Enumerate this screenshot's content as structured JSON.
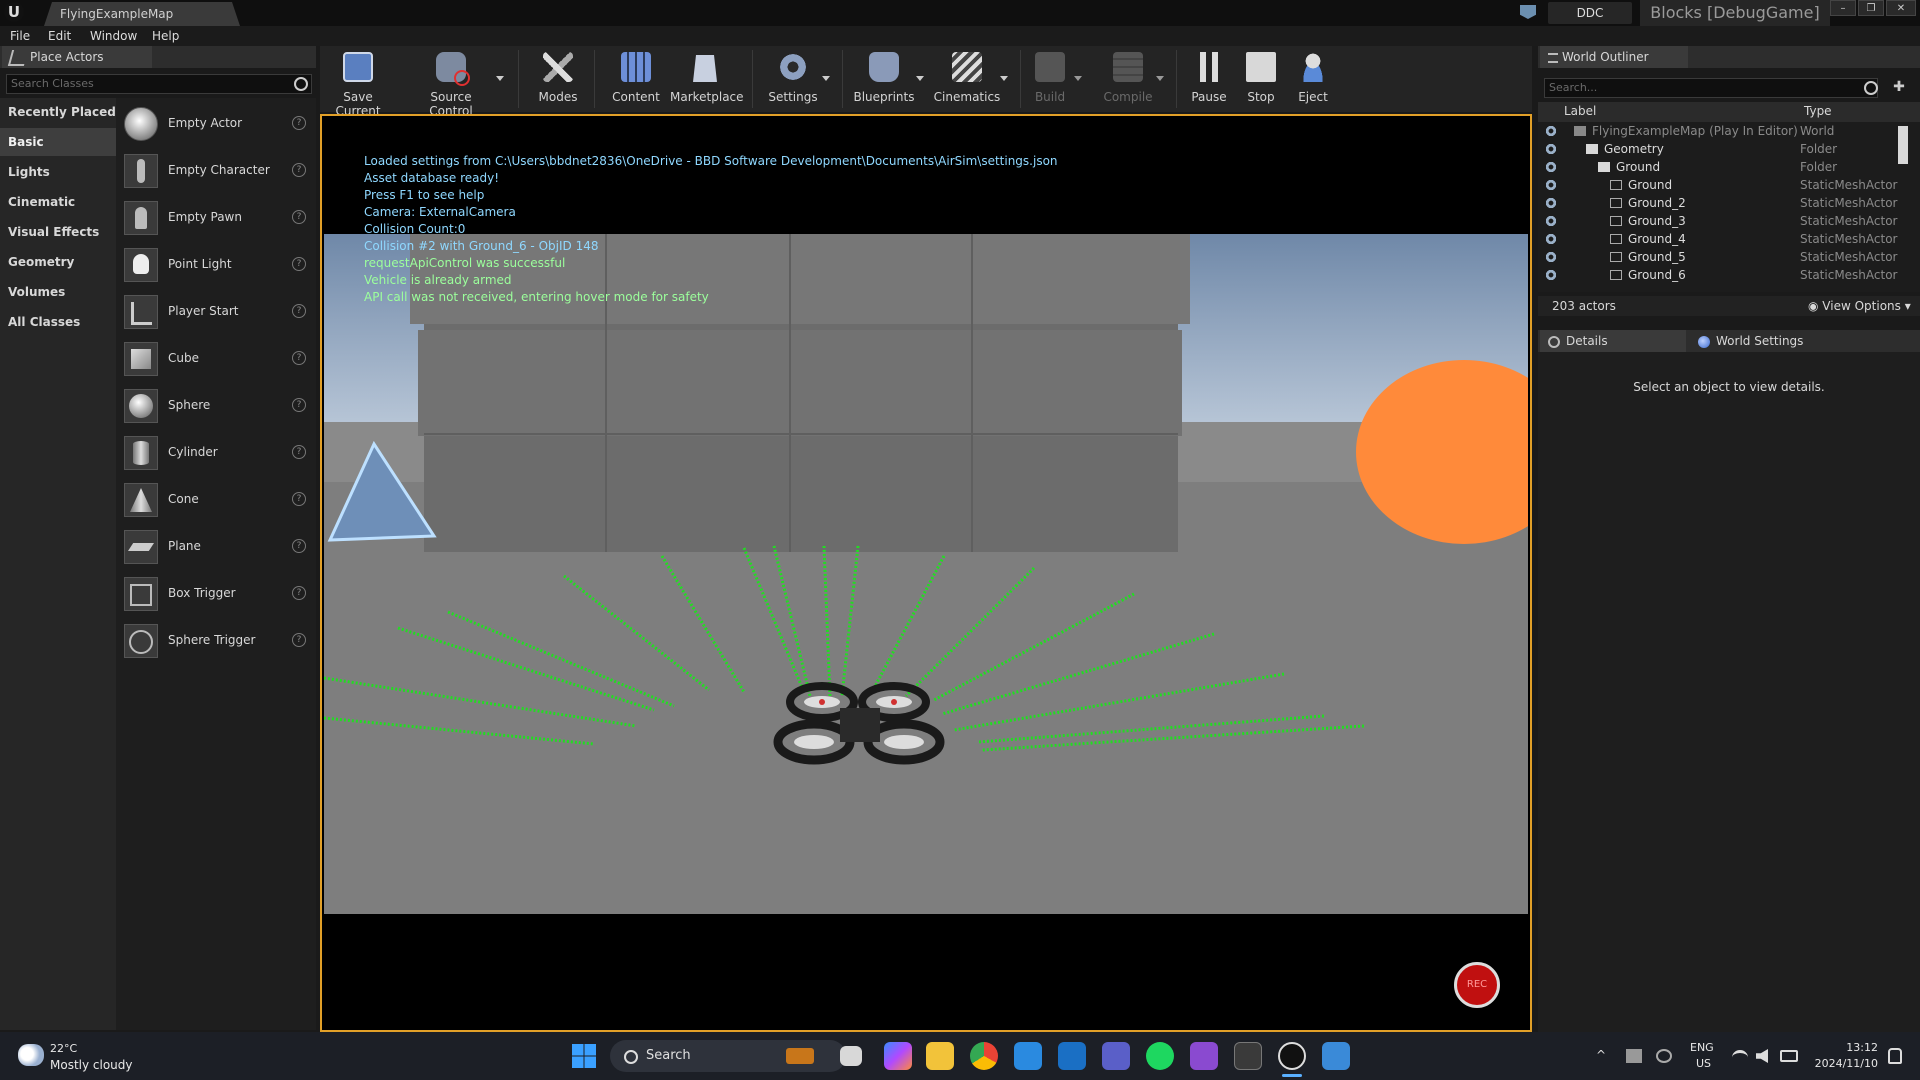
{
  "titlebar": {
    "map_tab": "FlyingExampleMap",
    "ddc": "DDC",
    "project": "Blocks [DebugGame]"
  },
  "menu": [
    "File",
    "Edit",
    "Window",
    "Help"
  ],
  "place_actors": {
    "tab": "Place Actors",
    "search_placeholder": "Search Classes",
    "categories": [
      "Recently Placed",
      "Basic",
      "Lights",
      "Cinematic",
      "Visual Effects",
      "Geometry",
      "Volumes",
      "All Classes"
    ],
    "active_category": "Basic",
    "actors": [
      "Empty Actor",
      "Empty Character",
      "Empty Pawn",
      "Point Light",
      "Player Start",
      "Cube",
      "Sphere",
      "Cylinder",
      "Cone",
      "Plane",
      "Box Trigger",
      "Sphere Trigger"
    ]
  },
  "toolbar": {
    "items": [
      {
        "label": "Save Current",
        "icon": "save-icon",
        "enabled": true
      },
      {
        "label": "Source Control",
        "icon": "source-control-icon",
        "enabled": true
      },
      {
        "label": "Modes",
        "icon": "modes-icon",
        "enabled": true
      },
      {
        "label": "Content",
        "icon": "content-icon",
        "enabled": true
      },
      {
        "label": "Marketplace",
        "icon": "marketplace-icon",
        "enabled": true
      },
      {
        "label": "Settings",
        "icon": "settings-icon",
        "enabled": true
      },
      {
        "label": "Blueprints",
        "icon": "blueprints-icon",
        "enabled": true
      },
      {
        "label": "Cinematics",
        "icon": "cinematics-icon",
        "enabled": true
      },
      {
        "label": "Build",
        "icon": "build-icon",
        "enabled": false
      },
      {
        "label": "Compile",
        "icon": "compile-icon",
        "enabled": false
      },
      {
        "label": "Pause",
        "icon": "pause-icon",
        "enabled": true
      },
      {
        "label": "Stop",
        "icon": "stop-icon",
        "enabled": true
      },
      {
        "label": "Eject",
        "icon": "eject-icon",
        "enabled": true
      }
    ]
  },
  "viewport": {
    "log": [
      {
        "text": "Loaded settings from C:\\Users\\bbdnet2836\\OneDrive - BBD Software Development\\Documents\\AirSim\\settings.json",
        "color": "#8fd8ff"
      },
      {
        "text": "Asset database ready!",
        "color": "#8fd8ff"
      },
      {
        "text": "Press F1 to see help",
        "color": "#8fd8ff"
      },
      {
        "text": "Camera: ExternalCamera",
        "color": "#8fd8ff"
      },
      {
        "text": "Collision Count:0",
        "color": "#8fd8ff"
      },
      {
        "text": "Collision #2 with Ground_6 - ObjID 148",
        "color": "#8fd8ff"
      },
      {
        "text": "requestApiControl was successful",
        "color": "#9cff9c"
      },
      {
        "text": "Vehicle is already armed",
        "color": "#9cff9c"
      },
      {
        "text": "API call was not received, entering hover mode for safety",
        "color": "#9cff9c"
      }
    ],
    "rec_label": "REC"
  },
  "outliner": {
    "tab": "World Outliner",
    "search_placeholder": "Search...",
    "col_label": "Label",
    "col_type": "Type",
    "rows": [
      {
        "label": "FlyingExampleMap (Play In Editor)",
        "type": "World",
        "indent": 0,
        "dim": true
      },
      {
        "label": "Geometry",
        "type": "Folder",
        "indent": 1,
        "dim": false
      },
      {
        "label": "Ground",
        "type": "Folder",
        "indent": 2,
        "dim": false
      },
      {
        "label": "Ground",
        "type": "StaticMeshActor",
        "indent": 3,
        "dim": false
      },
      {
        "label": "Ground_2",
        "type": "StaticMeshActor",
        "indent": 3,
        "dim": false
      },
      {
        "label": "Ground_3",
        "type": "StaticMeshActor",
        "indent": 3,
        "dim": false
      },
      {
        "label": "Ground_4",
        "type": "StaticMeshActor",
        "indent": 3,
        "dim": false
      },
      {
        "label": "Ground_5",
        "type": "StaticMeshActor",
        "indent": 3,
        "dim": false
      },
      {
        "label": "Ground_6",
        "type": "StaticMeshActor",
        "indent": 3,
        "dim": false
      }
    ],
    "actor_count": "203 actors",
    "view_options": "View Options"
  },
  "details": {
    "tab_details": "Details",
    "tab_world_settings": "World Settings",
    "empty_message": "Select an object to view details."
  },
  "taskbar": {
    "weather_temp": "22°C",
    "weather_desc": "Mostly cloudy",
    "search_label": "Search",
    "lang": "ENG",
    "region": "US",
    "time": "13:12",
    "date": "2024/11/10"
  },
  "colors": {
    "accent": "#e2a028",
    "lidar": "#22dd22",
    "sphere": "#ff8a3a"
  }
}
